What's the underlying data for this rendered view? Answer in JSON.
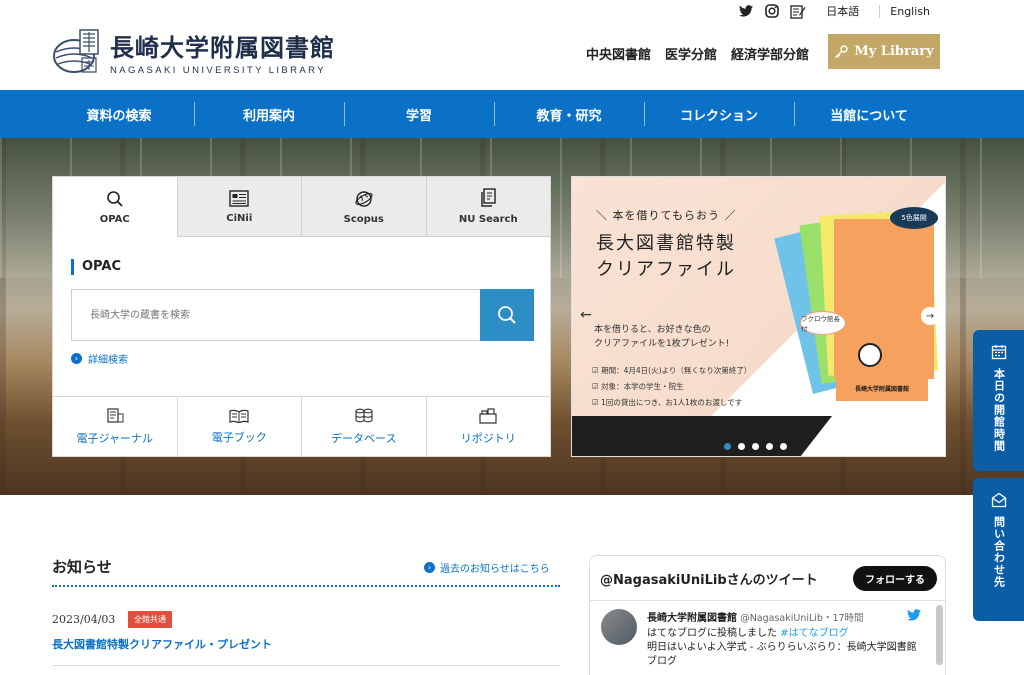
{
  "topbar": {
    "icons": [
      "twitter-icon",
      "instagram-icon",
      "blog-icon"
    ],
    "lang_ja": "日本語",
    "lang_en": "English"
  },
  "logo": {
    "jp": "長崎大学附属図書館",
    "en": "NAGASAKI UNIVERSITY LIBRARY"
  },
  "branches": [
    "中央図書館",
    "医学分館",
    "経済学部分館"
  ],
  "mylibrary": "My Library",
  "nav": [
    "資料の検索",
    "利用案内",
    "学習",
    "教育・研究",
    "コレクション",
    "当館について"
  ],
  "search": {
    "tabs": [
      {
        "label": "OPAC",
        "icon": "search-icon"
      },
      {
        "label": "CiNii",
        "icon": "newspaper-icon"
      },
      {
        "label": "Scopus",
        "icon": "globe-icon"
      },
      {
        "label": "NU Search",
        "icon": "documents-icon"
      }
    ],
    "heading": "OPAC",
    "placeholder": "長崎大学の蔵書を検索",
    "advanced": "詳細検索",
    "quick_links": [
      {
        "label": "電子ジャーナル",
        "icon": "ejournal-icon"
      },
      {
        "label": "電子ブック",
        "icon": "ebook-icon"
      },
      {
        "label": "データベース",
        "icon": "database-icon"
      },
      {
        "label": "リポジトリ",
        "icon": "repository-icon"
      }
    ]
  },
  "banner": {
    "sub": "＼ 本を借りてもらおう ／",
    "title_line1": "長大図書館特製",
    "title_line2": "クリアファイル",
    "desc_line1": "本を借りると、お好きな色の",
    "desc_line2": "クリアファイルを1枚プレゼント!",
    "items": [
      "期間：4月4日(火)より（無くなり次第終了）",
      "対象：本学の学生・院生",
      "1回の貸出につき、お1人1枚のお渡しです"
    ],
    "folder_note1": "5色展開",
    "folder_note2": "フクロウ館長付",
    "folder_label": "長崎大学附属図書館",
    "slide_count": 5,
    "active_slide": 1
  },
  "sidetabs": {
    "hours": "本日の開館時間",
    "contact": "問い合わせ先"
  },
  "news": {
    "heading": "お知らせ",
    "more": "過去のお知らせはこちら",
    "items": [
      {
        "date": "2023/04/03",
        "badge": "全館共通",
        "title": "長大図書館特製クリアファイル・プレゼント"
      }
    ]
  },
  "twitter": {
    "heading": "@NagasakiUniLibさんのツイート",
    "follow": "フォローする",
    "tweet": {
      "name": "長崎大学附属図書館",
      "handle": "@NagasakiUniLib・17時間",
      "text_prefix": "はてなブログに投稿しました ",
      "hashtag": "#はてなブログ",
      "text_rest": "明日はいよいよ入学式 - ぶらりらいぶらり：長崎大学図書館ブログ"
    }
  },
  "colors": {
    "nav_blue": "#0a71c7",
    "mylibrary_gold": "#c3a867",
    "badge_red": "#e0503c"
  }
}
